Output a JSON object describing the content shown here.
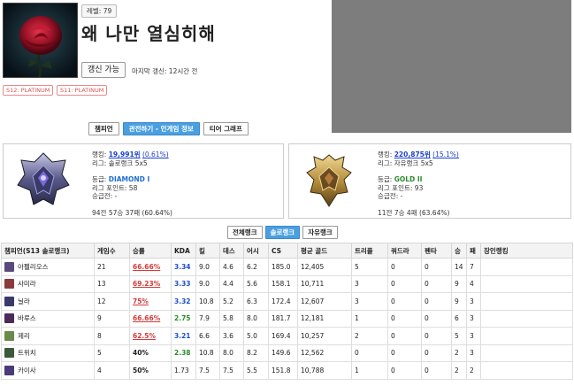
{
  "profile": {
    "level_badge": "레벨: 79",
    "summoner_name": "왜 나만 열심히해",
    "renew_label": "갱신 가능",
    "last_update": "마지막 갱신: 12시간 전",
    "past_tiers": [
      "S12: PLATINUM",
      "S11: PLATINUM"
    ]
  },
  "main_tabs": [
    "챔피언",
    "관전하기 - 인게임 정보",
    "티어 그래프"
  ],
  "solo_rank": {
    "rank_label": "랭킹: ",
    "rank_value": "19,991위",
    "rank_pct": "(0.61%)",
    "league_name": "리그: 솔로랭크 5x5",
    "tier_label": "등급: ",
    "tier_value": "DIAMOND I",
    "lp": "리그 포인트: 58",
    "promo": "승급전: -",
    "record": "94전 57승 37패 (60.64%)"
  },
  "flex_rank": {
    "rank_label": "랭킹: ",
    "rank_value": "220,875위",
    "rank_pct": "(15.1%)",
    "league_name": "리그: 자유랭크 5x5",
    "tier_label": "등급: ",
    "tier_value": "GOLD II",
    "lp": "리그 포인트: 93",
    "promo": "승급전: -",
    "record": "11전 7승 4패 (63.64%)"
  },
  "queue_tabs": [
    "전체랭크",
    "솔로랭크",
    "자유랭크"
  ],
  "table": {
    "headers": [
      "챔피언(S13 솔로랭크)",
      "게임수",
      "승률",
      "KDA",
      "킬",
      "데스",
      "어시",
      "CS",
      "평균 골드",
      "트리플",
      "쿼드라",
      "펜타",
      "승",
      "패",
      "장인랭킹"
    ],
    "rows": [
      {
        "champ": "아펠리오스",
        "games": "21",
        "wr": "66.66%",
        "wr_style": "red",
        "kda": "3.34",
        "kda_style": "blue",
        "k": "9.0",
        "d": "4.6",
        "a": "6.2",
        "cs": "185.0",
        "gold": "12,405",
        "triple": "5",
        "quadra": "0",
        "penta": "0",
        "w": "14",
        "l": "7",
        "icon": "#5a4a7a"
      },
      {
        "champ": "사미라",
        "games": "13",
        "wr": "69.23%",
        "wr_style": "red",
        "kda": "3.33",
        "kda_style": "blue",
        "k": "9.0",
        "d": "4.4",
        "a": "5.6",
        "cs": "158.1",
        "gold": "10,711",
        "triple": "3",
        "quadra": "0",
        "penta": "0",
        "w": "9",
        "l": "4",
        "icon": "#8a3a3a"
      },
      {
        "champ": "닐라",
        "games": "12",
        "wr": "75%",
        "wr_style": "red",
        "kda": "3.32",
        "kda_style": "blue",
        "k": "10.8",
        "d": "5.2",
        "a": "6.3",
        "cs": "172.4",
        "gold": "12,607",
        "triple": "3",
        "quadra": "0",
        "penta": "0",
        "w": "9",
        "l": "3",
        "icon": "#3a3a6a"
      },
      {
        "champ": "바루스",
        "games": "9",
        "wr": "66.66%",
        "wr_style": "red",
        "kda": "2.75",
        "kda_style": "green",
        "k": "7.9",
        "d": "5.8",
        "a": "8.0",
        "cs": "181.7",
        "gold": "12,181",
        "triple": "1",
        "quadra": "0",
        "penta": "0",
        "w": "6",
        "l": "3",
        "icon": "#4a2a5a"
      },
      {
        "champ": "제리",
        "games": "8",
        "wr": "62.5%",
        "wr_style": "red",
        "kda": "3.21",
        "kda_style": "blue",
        "k": "6.6",
        "d": "3.6",
        "a": "5.0",
        "cs": "169.4",
        "gold": "10,257",
        "triple": "2",
        "quadra": "0",
        "penta": "0",
        "w": "5",
        "l": "3",
        "icon": "#6a8a4a"
      },
      {
        "champ": "트위치",
        "games": "5",
        "wr": "40%",
        "wr_style": "plain",
        "kda": "2.38",
        "kda_style": "green",
        "k": "10.8",
        "d": "8.0",
        "a": "8.2",
        "cs": "149.6",
        "gold": "12,562",
        "triple": "0",
        "quadra": "0",
        "penta": "0",
        "w": "2",
        "l": "3",
        "icon": "#3a5a3a"
      },
      {
        "champ": "카이사",
        "games": "4",
        "wr": "50%",
        "wr_style": "plain",
        "kda": "1.73",
        "kda_style": "plain",
        "k": "7.5",
        "d": "7.5",
        "a": "5.5",
        "cs": "151.8",
        "gold": "10,788",
        "triple": "1",
        "quadra": "0",
        "penta": "0",
        "w": "2",
        "l": "2",
        "icon": "#4a3a7a"
      }
    ]
  },
  "colors": {
    "accent": "#4a9fe0",
    "winrate_red": "#d43a3a",
    "kda_blue": "#1e4fcf",
    "kda_green": "#2a8c2a",
    "ad_gray": "#7d7d7d"
  }
}
